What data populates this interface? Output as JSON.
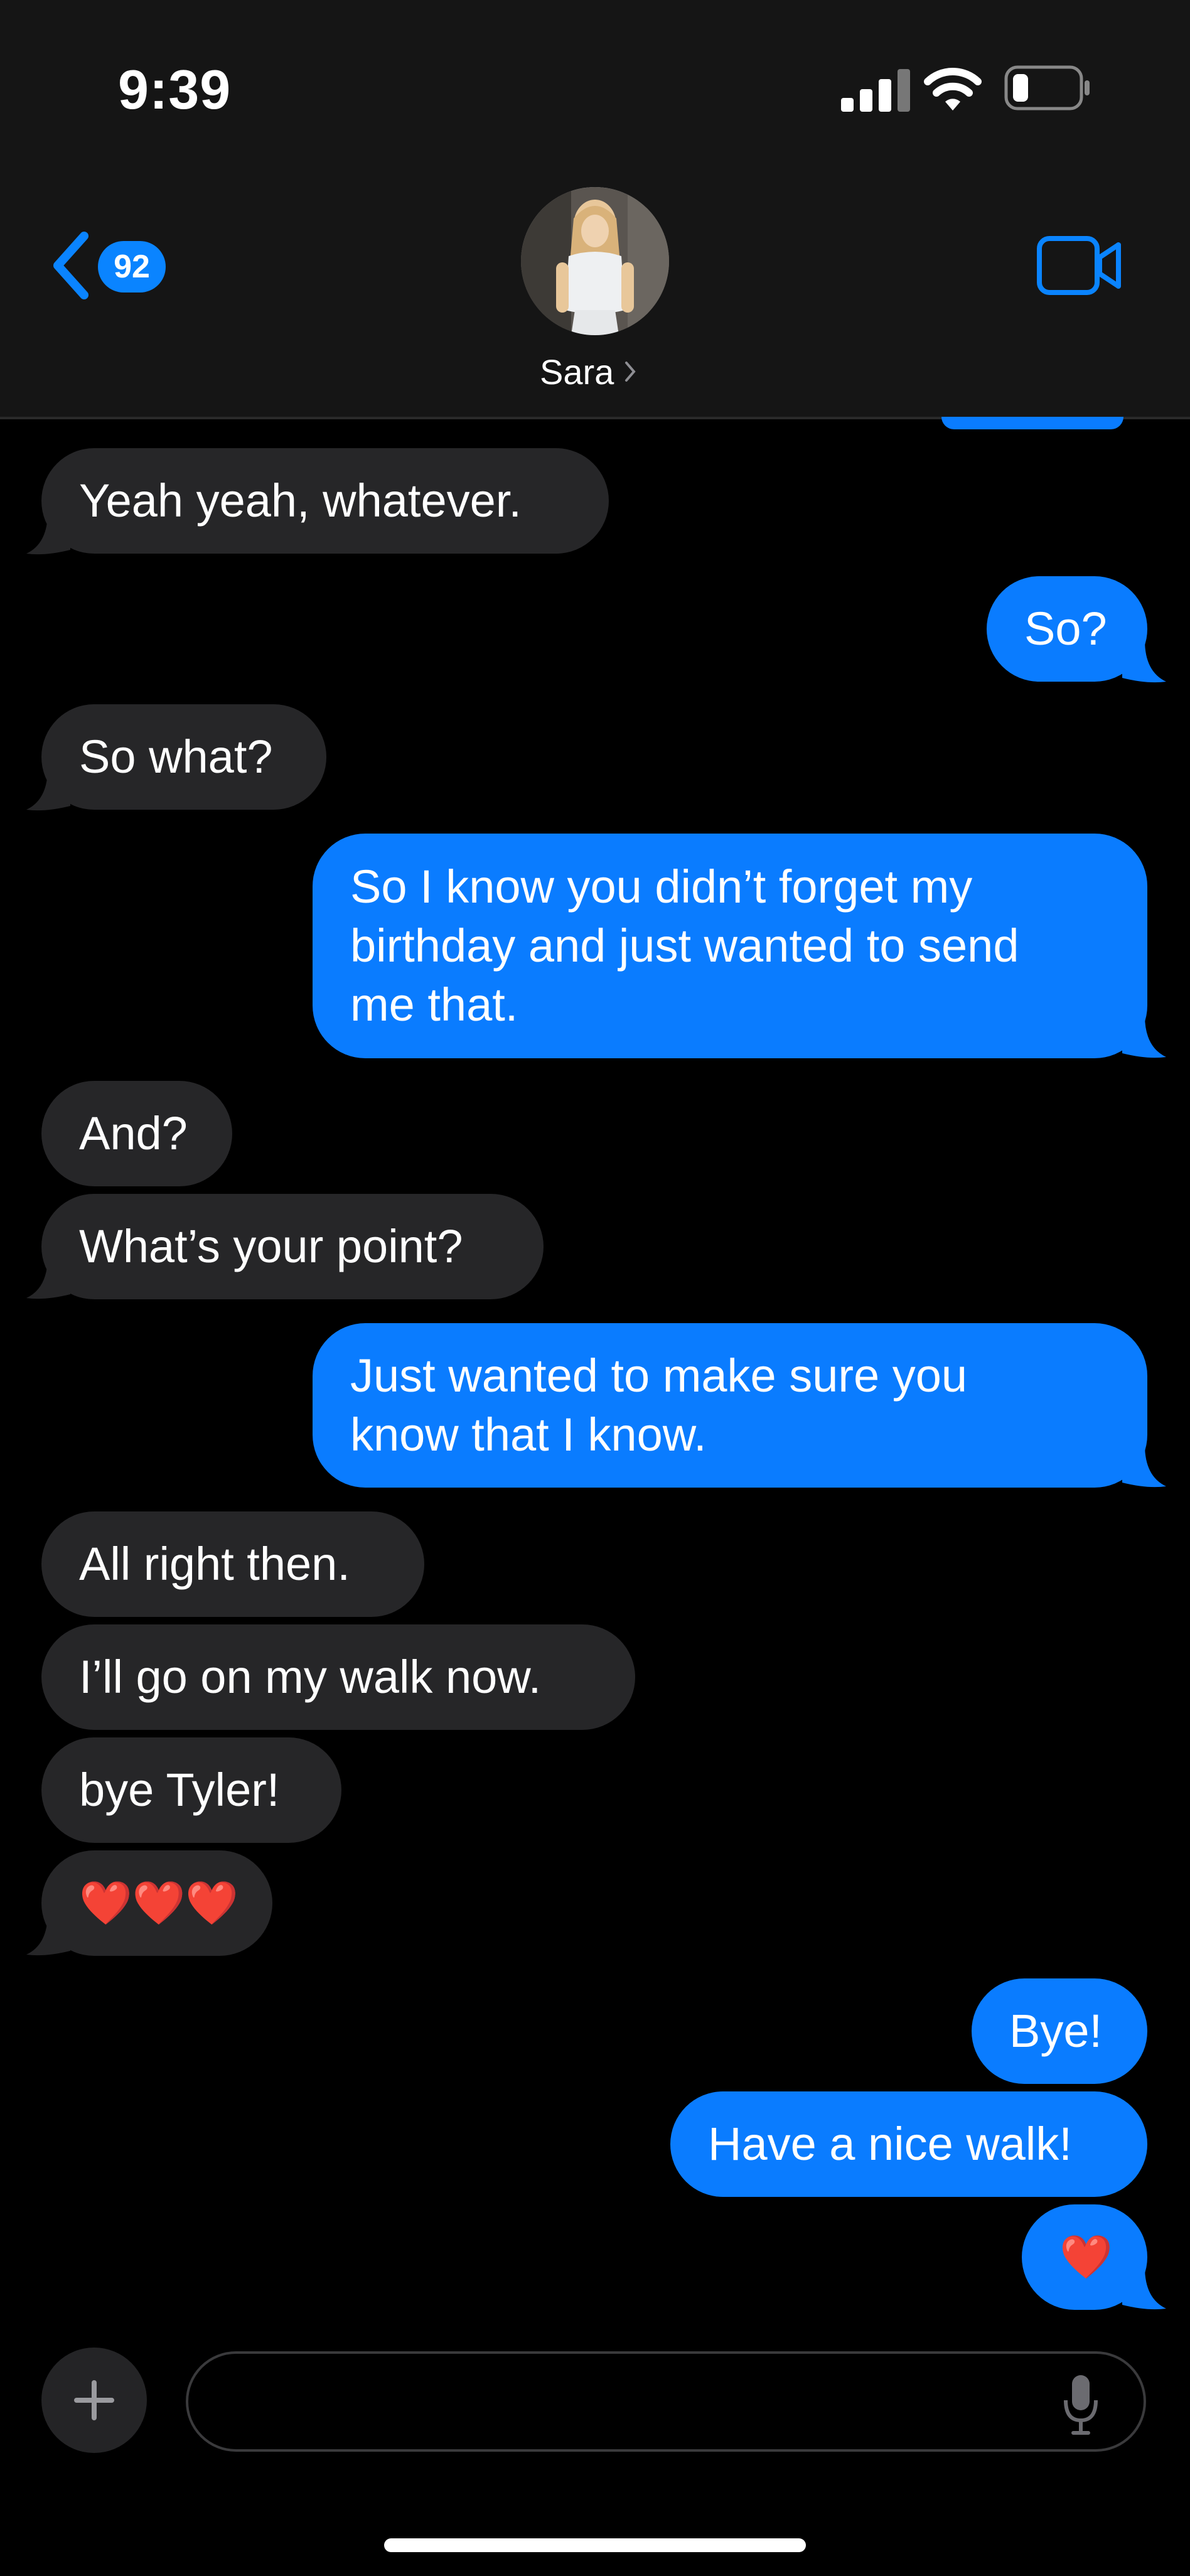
{
  "status_bar": {
    "time": "9:39"
  },
  "header": {
    "back_badge": "92",
    "contact_name": "Sara"
  },
  "messages": [
    {
      "from": "contact",
      "text": "Yeah yeah, whatever."
    },
    {
      "from": "me",
      "text": "So?"
    },
    {
      "from": "contact",
      "text": "So what?"
    },
    {
      "from": "me",
      "lines": [
        "So I know you didn’t forget my",
        "birthday and just wanted to send",
        "me that."
      ]
    },
    {
      "from": "contact",
      "text": "And?"
    },
    {
      "from": "contact",
      "text": "What’s your point?"
    },
    {
      "from": "me",
      "lines": [
        "Just wanted to make sure you",
        "know that I know."
      ]
    },
    {
      "from": "contact",
      "text": "All right then."
    },
    {
      "from": "contact",
      "text": "I’ll go on my walk now."
    },
    {
      "from": "contact",
      "text": "bye Tyler!"
    },
    {
      "from": "contact",
      "text": "❤️❤️❤️"
    },
    {
      "from": "me",
      "text": "Bye!"
    },
    {
      "from": "me",
      "text": "Have a nice walk!"
    },
    {
      "from": "me",
      "text": "❤️"
    }
  ],
  "composer": {
    "value": "",
    "placeholder": ""
  },
  "colors": {
    "outgoing_bubble": "#0a7cff",
    "incoming_bubble": "#262628",
    "accent": "#0a84ff",
    "background": "#000000"
  },
  "icons": [
    "back-chevron-icon",
    "video-camera-icon",
    "plus-icon",
    "microphone-icon",
    "cellular-signal-icon",
    "wifi-icon",
    "battery-icon"
  ]
}
